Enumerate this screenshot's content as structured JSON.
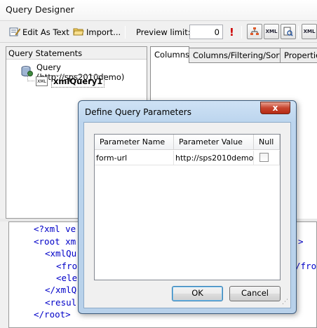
{
  "window": {
    "title": "Query Designer"
  },
  "toolbar": {
    "edit_as_text": "Edit As Text",
    "import": "Import...",
    "preview_limit_label": "Preview limit:",
    "preview_limit_value": "0",
    "buttons": [
      {
        "icon": "run-query-icon",
        "label": "!"
      },
      {
        "icon": "query-tree-icon",
        "label": ""
      },
      {
        "icon": "xml-view-icon",
        "label": "XML"
      },
      {
        "icon": "xml-preview-icon",
        "label": ""
      },
      {
        "icon": "xml-options-icon",
        "label": "XML"
      }
    ]
  },
  "query_statements": {
    "header": "Query Statements",
    "connection": "Query (http://sps2010demo)",
    "query_item": "xmlQuery1",
    "query_icon_label": "XML"
  },
  "tabs": [
    {
      "label": "Columns",
      "active": true
    },
    {
      "label": "Columns/Filtering/Sorting",
      "active": false
    },
    {
      "label": "Properties",
      "active": false
    }
  ],
  "code": {
    "lines": [
      "<?xml ve",
      "<root xm",
      "<xmlQu",
      "<fro",
      "<ele",
      "</xmlQ",
      "<resul",
      "</root>"
    ],
    "right_fragments": [
      ">",
      "/fro"
    ]
  },
  "dialog": {
    "title": "Define Query Parameters",
    "close_label": "x",
    "columns": [
      "Parameter Name",
      "Parameter Value",
      "Null"
    ],
    "rows": [
      {
        "name": "form-url",
        "value": "http://sps2010demo...",
        "null": false
      }
    ],
    "ok_label": "OK",
    "cancel_label": "Cancel"
  }
}
